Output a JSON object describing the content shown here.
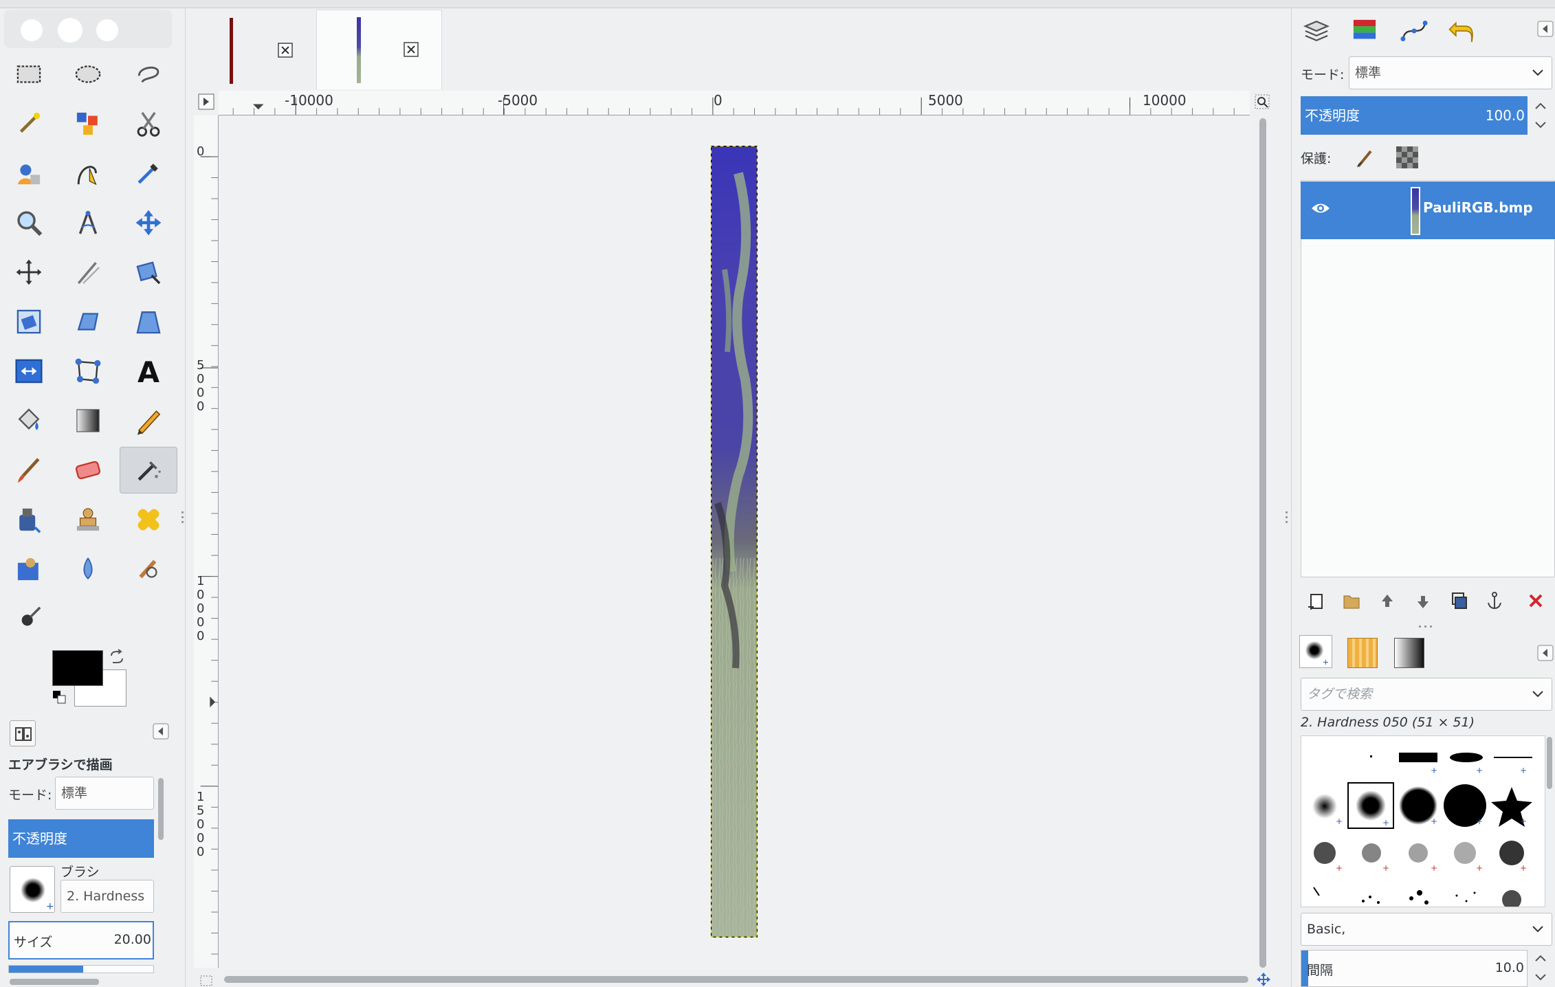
{
  "toolbox": {
    "options_title": "エアブラシで描画",
    "mode_label": "モード:",
    "mode_value": "標準",
    "opacity_label": "不透明度",
    "brush_label": "ブラシ",
    "brush_value": "2. Hardness",
    "size_label": "サイズ",
    "size_value": "20.00"
  },
  "image_tabs": [
    {
      "name": "tab-1",
      "active": false
    },
    {
      "name": "tab-2",
      "active": true
    }
  ],
  "rulers": {
    "h_ticks": [
      "-10000",
      "-5000",
      "0",
      "5000",
      "10000"
    ],
    "v_ticks": [
      "0",
      "5000",
      "10000",
      "15000"
    ]
  },
  "layers_panel": {
    "mode_label": "モード:",
    "mode_value": "標準",
    "opacity_label": "不透明度",
    "opacity_value": "100.0",
    "opacity_fraction": 1.0,
    "protect_label": "保護:",
    "layer_name": "PauliRGB.bmp"
  },
  "brushes_panel": {
    "tag_search_placeholder": "タグで検索",
    "current_brush": "2. Hardness 050 (51 × 51)",
    "preset_value": "Basic,",
    "spacing_label": "間隔",
    "spacing_value": "10.0"
  },
  "colors": {
    "selection_blue": "#3f84d6",
    "fg_color": "#000000",
    "bg_color": "#ffffff"
  }
}
